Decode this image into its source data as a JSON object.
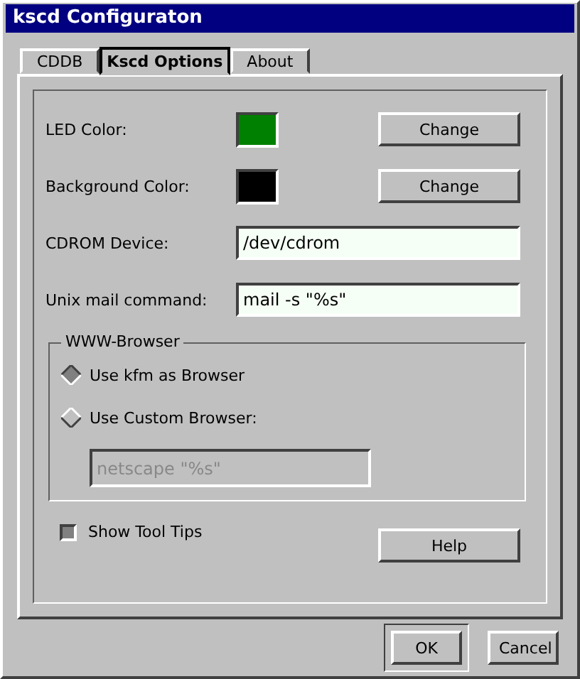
{
  "window": {
    "title": "kscd Configuraton"
  },
  "tabs": [
    {
      "label": "CDDB",
      "selected": false
    },
    {
      "label": "Kscd Options",
      "selected": true
    },
    {
      "label": "About",
      "selected": false
    }
  ],
  "colors": [
    {
      "label": "LED Color:",
      "color": "#008000",
      "button": "Change"
    },
    {
      "label": "Background Color:",
      "color": "#000000",
      "button": "Change"
    }
  ],
  "fields": [
    {
      "label": "CDROM Device:",
      "value": "/dev/cdrom"
    },
    {
      "label": "Unix mail command:",
      "value": "mail -s \"%s\""
    }
  ],
  "browser_group": {
    "title": "WWW-Browser",
    "options": [
      {
        "label": "Use kfm as Browser",
        "selected": true
      },
      {
        "label": "Use Custom Browser:",
        "selected": false
      }
    ],
    "custom_field": {
      "value": "netscape \"%s\"",
      "disabled": true
    }
  },
  "tool_tips": {
    "label": "Show Tool Tips",
    "checked": true
  },
  "help_button": "Help",
  "buttons": [
    {
      "label": "OK",
      "default": true
    },
    {
      "label": "Cancel",
      "default": false
    }
  ]
}
